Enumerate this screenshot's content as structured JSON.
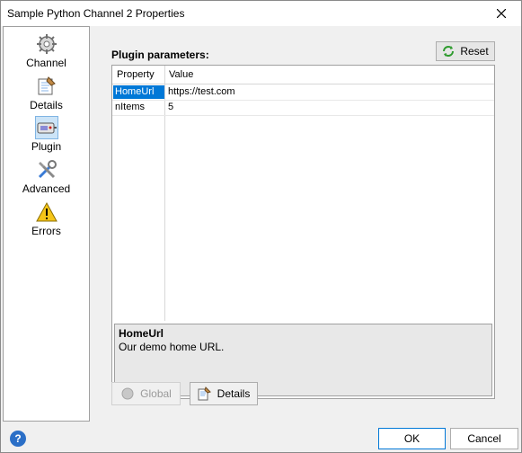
{
  "window": {
    "title": "Sample Python Channel 2 Properties"
  },
  "sidebar": {
    "items": [
      {
        "label": "Channel",
        "icon": "gear-icon"
      },
      {
        "label": "Details",
        "icon": "details-icon"
      },
      {
        "label": "Plugin",
        "icon": "plugin-icon",
        "selected": true
      },
      {
        "label": "Advanced",
        "icon": "tools-icon"
      },
      {
        "label": "Errors",
        "icon": "warning-icon"
      }
    ]
  },
  "main": {
    "section_title": "Plugin parameters:",
    "reset_label": "Reset",
    "grid": {
      "headers": [
        "Property",
        "Value"
      ],
      "rows": [
        {
          "property": "HomeUrl",
          "value": "https://test.com",
          "selected": true
        },
        {
          "property": "nItems",
          "value": "5"
        }
      ]
    },
    "description": {
      "title": "HomeUrl",
      "text": "Our demo home URL."
    },
    "global_label": "Global",
    "details_label": "Details"
  },
  "footer": {
    "ok_label": "OK",
    "cancel_label": "Cancel"
  },
  "colors": {
    "selection": "#0078d7",
    "accent_border": "#0078d7"
  }
}
